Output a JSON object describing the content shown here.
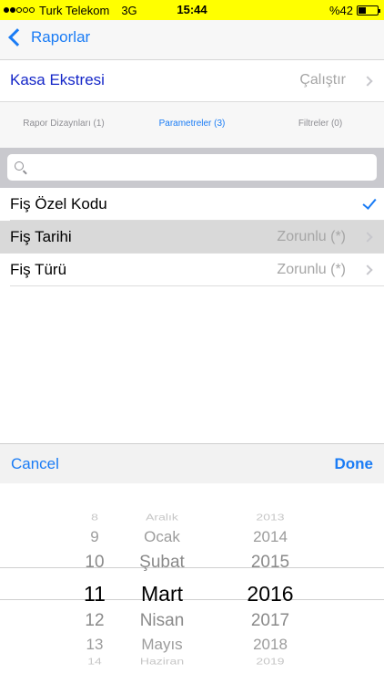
{
  "status_bar": {
    "carrier": "Turk Telekom",
    "network": "3G",
    "time": "15:44",
    "battery": "%42",
    "battery_level": 0.42
  },
  "nav": {
    "back_label": "Raporlar"
  },
  "report": {
    "title": "Kasa Ekstresi",
    "run_label": "Çalıştır"
  },
  "tabs": [
    {
      "label": "Rapor Dizaynları (1)",
      "active": false
    },
    {
      "label": "Parametreler (3)",
      "active": true
    },
    {
      "label": "Filtreler (0)",
      "active": false
    }
  ],
  "search": {
    "placeholder": "",
    "value": ""
  },
  "params": [
    {
      "label": "Fiş Özel Kodu",
      "value": "",
      "checked": true,
      "selected": false
    },
    {
      "label": "Fiş Tarihi",
      "value": "Zorunlu (*)",
      "checked": false,
      "selected": true
    },
    {
      "label": "Fiş Türü",
      "value": "Zorunlu (*)",
      "checked": false,
      "selected": false
    }
  ],
  "toolbar": {
    "cancel_label": "Cancel",
    "done_label": "Done"
  },
  "picker": {
    "days": [
      "8",
      "9",
      "10",
      "11",
      "12",
      "13",
      "14"
    ],
    "months": [
      "Aralık",
      "Ocak",
      "Şubat",
      "Mart",
      "Nisan",
      "Mayıs",
      "Haziran"
    ],
    "years": [
      "2013",
      "2014",
      "2015",
      "2016",
      "2017",
      "2018",
      "2019"
    ],
    "selected_index": 3
  },
  "colors": {
    "status_bg": "#ffff00",
    "accent": "#1a7cf5",
    "report_title": "#1426c8",
    "selected_row": "#d9d9d9"
  }
}
